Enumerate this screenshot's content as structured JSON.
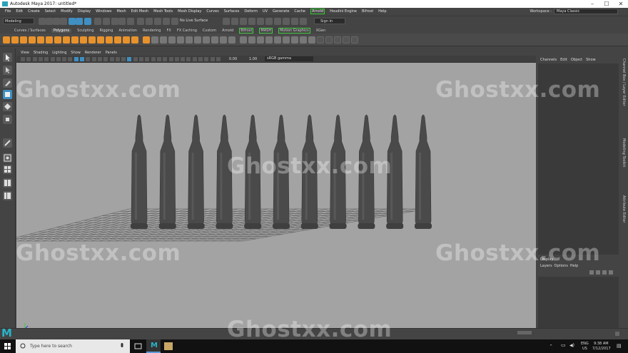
{
  "window": {
    "title": "Autodesk Maya 2017: untitled*"
  },
  "menubar": {
    "items": [
      "File",
      "Edit",
      "Create",
      "Select",
      "Modify",
      "Display",
      "Windows",
      "Mesh",
      "Edit Mesh",
      "Mesh Tools",
      "Mesh Display",
      "Curves",
      "Surfaces",
      "Deform",
      "UV",
      "Generate",
      "Cache",
      "Arnold",
      "Houdini Engine",
      "Bifrost",
      "Help"
    ],
    "highlighted": "Arnold"
  },
  "workspace": {
    "label": "Workspace :",
    "value": "Maya Classic"
  },
  "statusline": {
    "menuset": "Modeling",
    "live_surface": "No Live Surface",
    "signin": "Sign In"
  },
  "shelf_tabs": [
    "Curves / Surfaces",
    "Polygons",
    "Sculpting",
    "Rigging",
    "Animation",
    "Rendering",
    "FX",
    "FX Caching",
    "Custom",
    "Arnold",
    "Bifrost",
    "MASH",
    "Motion Graphics",
    "XGen"
  ],
  "shelf_active": "Polygons",
  "viewport": {
    "menu": [
      "View",
      "Shading",
      "Lighting",
      "Show",
      "Renderer",
      "Panels"
    ],
    "fields": {
      "near": "0.00",
      "far": "1.00",
      "colorspace": "sRGB gamma"
    },
    "object_count": 11
  },
  "channel_box": {
    "tabs": [
      "Channels",
      "Edit",
      "Object",
      "Show"
    ]
  },
  "layer_editor": {
    "header": "Display",
    "tabs": [
      "Layers",
      "Options",
      "Help"
    ]
  },
  "side_tabs": [
    "Channel Box / Layer Editor",
    "Modeling Toolkit",
    "Attribute Editor"
  ],
  "watermark": "Ghostxx.com",
  "taskbar": {
    "search_placeholder": "Type here to search",
    "lang": "ENG",
    "region": "US",
    "time": "9:38 AM",
    "date": "7/12/2017"
  },
  "colors": {
    "viewport_bg": "#a3a3a3",
    "accent": "#29b3c8",
    "shelf_icon": "#e8922c",
    "bullet": "#4a4a4a"
  }
}
